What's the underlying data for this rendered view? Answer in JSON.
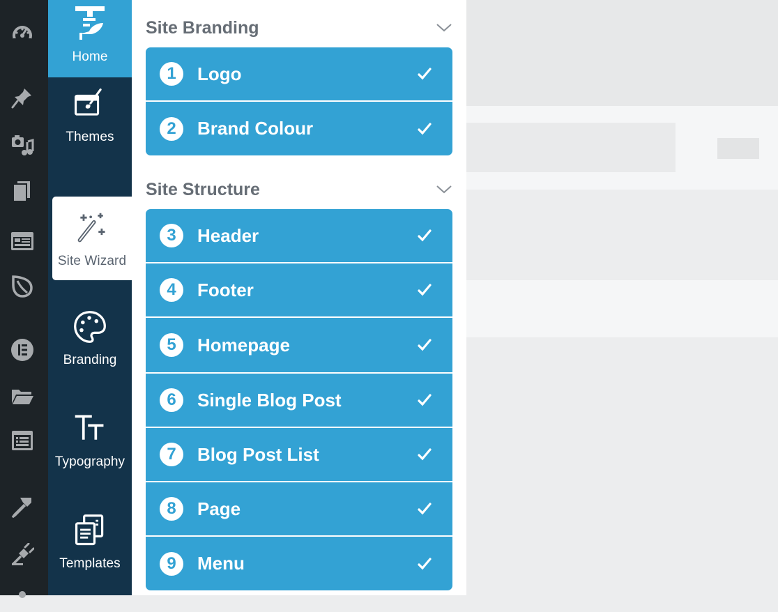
{
  "wp_sidebar": {
    "icons": [
      "dashboard-icon",
      "pin-icon",
      "media-icon",
      "pages-icon",
      "layout-icon",
      "leaf-icon",
      "elementor-icon",
      "folder-icon",
      "forms-icon",
      "brush-icon",
      "plugin-icon"
    ]
  },
  "plugin_nav": {
    "items": [
      {
        "label": "Home",
        "icon": "home-logo-icon",
        "state": "brand"
      },
      {
        "label": "Themes",
        "icon": "themes-icon",
        "state": "normal"
      },
      {
        "label": "Site Wizard",
        "icon": "magic-wand-icon",
        "state": "active"
      },
      {
        "label": "Branding",
        "icon": "palette-icon",
        "state": "normal"
      },
      {
        "label": "Typography",
        "icon": "typography-icon",
        "state": "normal"
      },
      {
        "label": "Templates",
        "icon": "templates-icon",
        "state": "normal"
      }
    ]
  },
  "wizard": {
    "sections": [
      {
        "title": "Site Branding",
        "steps": [
          {
            "num": "1",
            "label": "Logo",
            "done": true
          },
          {
            "num": "2",
            "label": "Brand Colour",
            "done": true
          }
        ]
      },
      {
        "title": "Site Structure",
        "steps": [
          {
            "num": "3",
            "label": "Header",
            "done": true
          },
          {
            "num": "4",
            "label": "Footer",
            "done": true
          },
          {
            "num": "5",
            "label": "Homepage",
            "done": true
          },
          {
            "num": "6",
            "label": "Single Blog Post",
            "done": true
          },
          {
            "num": "7",
            "label": "Blog Post List",
            "done": true
          },
          {
            "num": "8",
            "label": "Page",
            "done": true
          },
          {
            "num": "9",
            "label": "Menu",
            "done": true
          }
        ]
      }
    ]
  },
  "colors": {
    "accent": "#33a2d4",
    "nav_bg": "#13334a",
    "wp_bg": "#1d2327"
  }
}
